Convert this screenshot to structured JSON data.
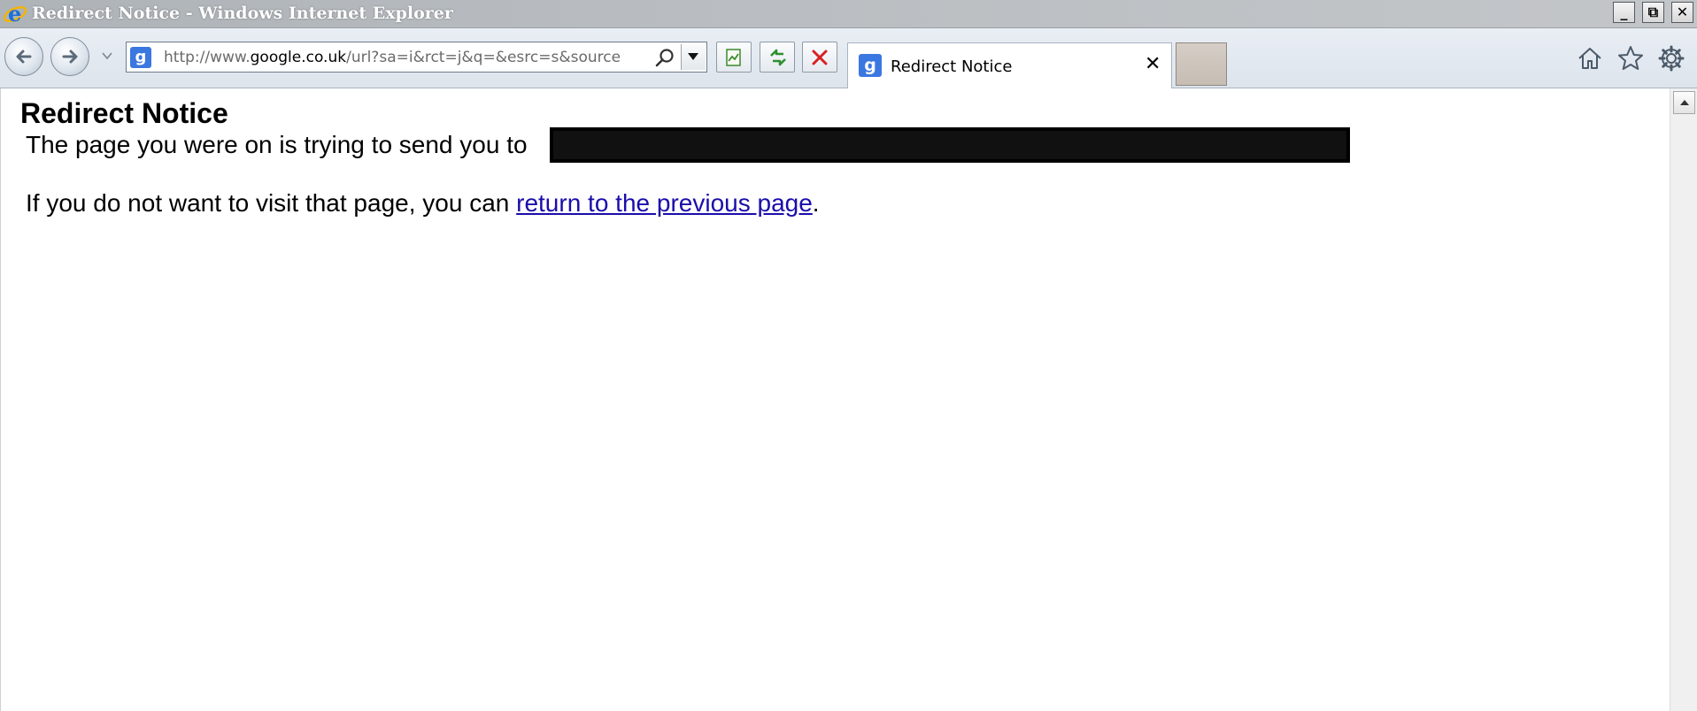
{
  "window": {
    "title": "Redirect Notice - Windows Internet Explorer",
    "controls": {
      "minimize": "_",
      "maximize": "⧉",
      "close": "✕"
    }
  },
  "toolbar": {
    "address": {
      "scheme": "http://www.",
      "host": "google.co.uk",
      "path": "/url?sa=i&rct=j&q=&esrc=s&source"
    },
    "favicon_letter": "g",
    "icons": {
      "back": "back-arrow-icon",
      "forward": "forward-arrow-icon",
      "search": "search-icon",
      "compat": "compatibility-view-icon",
      "refresh": "refresh-icon",
      "stop": "stop-icon",
      "home": "home-icon",
      "favorites": "star-icon",
      "tools": "gear-icon"
    }
  },
  "tab": {
    "label": "Redirect Notice",
    "close": "✕"
  },
  "page": {
    "title": "Redirect Notice",
    "line1_text": "The page you were on is trying to send you to ",
    "line2_prefix": "If you do not want to visit that page, you can ",
    "line2_link": "return to the previous page",
    "line2_suffix": "."
  },
  "colors": {
    "link": "#1a0dab",
    "accent": "#3b77e0",
    "stop_red": "#d82020"
  }
}
